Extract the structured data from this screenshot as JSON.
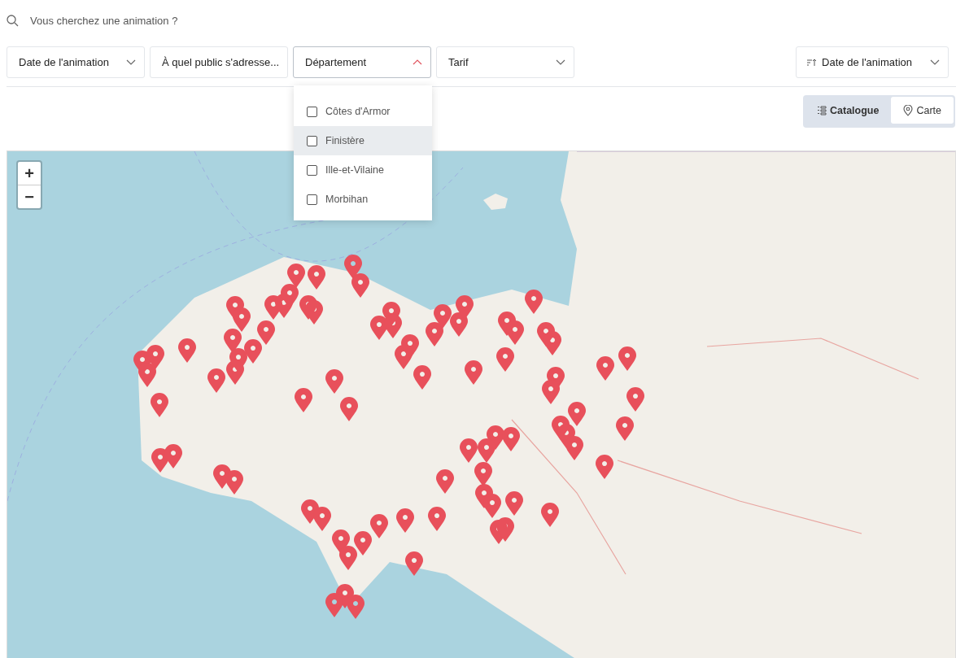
{
  "search": {
    "placeholder": "Vous cherchez une animation ?"
  },
  "filters": [
    {
      "label": "Date de l'animation",
      "open": false
    },
    {
      "label": "À quel public s'adresse...",
      "open": false
    },
    {
      "label": "Département",
      "open": true
    },
    {
      "label": "Tarif",
      "open": false
    }
  ],
  "sort": {
    "label": "Date de l'animation"
  },
  "department_options": [
    {
      "label": "Côtes d'Armor",
      "checked": false,
      "highlighted": false
    },
    {
      "label": "Finistère",
      "checked": false,
      "highlighted": true
    },
    {
      "label": "Ille-et-Vilaine",
      "checked": false,
      "highlighted": false
    },
    {
      "label": "Morbihan",
      "checked": false,
      "highlighted": false
    }
  ],
  "view_toggle": [
    {
      "label": "Catalogue",
      "kind": "list",
      "selected": false
    },
    {
      "label": "Carte",
      "kind": "map",
      "selected": true
    }
  ],
  "map": {
    "zoom_in": "+",
    "zoom_out": "−"
  }
}
